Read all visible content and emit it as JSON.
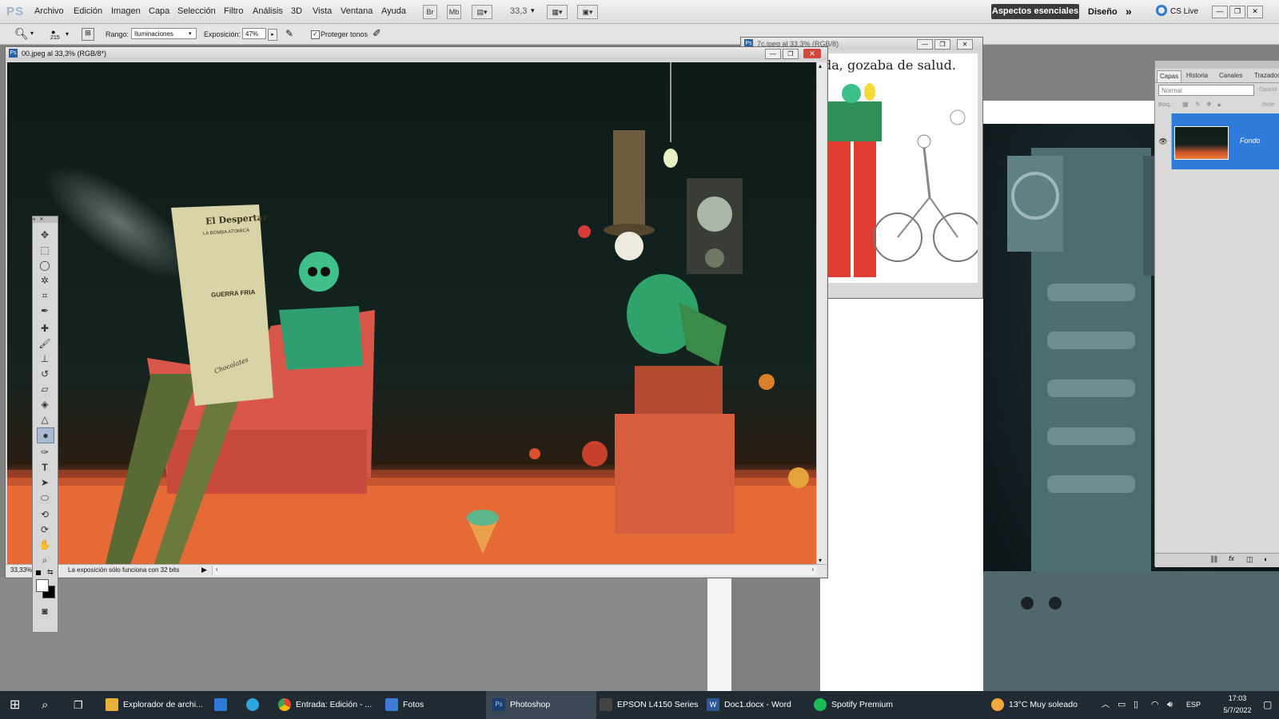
{
  "app": {
    "logo": "PS"
  },
  "menubar": {
    "items": [
      "Archivo",
      "Edición",
      "Imagen",
      "Capa",
      "Selección",
      "Filtro",
      "Análisis",
      "3D",
      "Vista",
      "Ventana",
      "Ayuda"
    ],
    "bridge_btn": "Br",
    "minibridge_btn": "Mb",
    "zoom_value": "33,3",
    "workspace_active": "Aspectos esenciales",
    "workspace_design": "Diseño",
    "more": "»",
    "cslive": "CS Live"
  },
  "options": {
    "brush_size": "215",
    "range_label": "Rango:",
    "range_value": "Iluminaciones",
    "exposure_label": "Exposición:",
    "exposure_value": "47%",
    "protect_tones": "Proteger tonos"
  },
  "doc_main": {
    "title": "00.jpeg al 33,3% (RGB/8*)",
    "zoom": "33,33%",
    "status": "La exposición sólo funciona con 32 bits",
    "newspaper": "El Despertar",
    "headline1": "LA BOMBA ATOMICA",
    "headline2": "GUERRA FRIA",
    "chocolates": "Chocolates"
  },
  "doc_second": {
    "title": "7c.jpeg al 33,3% (RGB/8)",
    "text": "da, gozaba de salud."
  },
  "layers_panel": {
    "tabs": [
      "Capas",
      "Historia",
      "Canales",
      "Trazados"
    ],
    "blend_mode": "Normal",
    "opacity_label": "Opacid",
    "lock_label": "Bloq.:",
    "fill_label": "Relle",
    "layer_name": "Fondo"
  },
  "taskbar": {
    "items": [
      {
        "label": "Explorador de archi...",
        "icon": "folder-icon",
        "color": "#e8b23a"
      },
      {
        "label": "",
        "icon": "mail-icon",
        "color": "#2d7ad6"
      },
      {
        "label": "",
        "icon": "edge-icon",
        "color": "#2fa4d8"
      },
      {
        "label": "Entrada: Edición - ...",
        "icon": "chrome-icon",
        "color": "#e94235"
      },
      {
        "label": "Fotos",
        "icon": "photos-icon",
        "color": "#3a7bd5"
      },
      {
        "label": "Photoshop",
        "icon": "photoshop-icon",
        "color": "#1b3e6e"
      },
      {
        "label": "EPSON L4150 Series",
        "icon": "printer-icon",
        "color": "#444444"
      },
      {
        "label": "Doc1.docx - Word",
        "icon": "word-icon",
        "color": "#2b5797"
      },
      {
        "label": "Spotify Premium",
        "icon": "spotify-icon",
        "color": "#1db954"
      }
    ],
    "weather": "13°C  Muy soleado",
    "lang": "ESP",
    "time": "17:03",
    "date": "5/7/2022"
  }
}
